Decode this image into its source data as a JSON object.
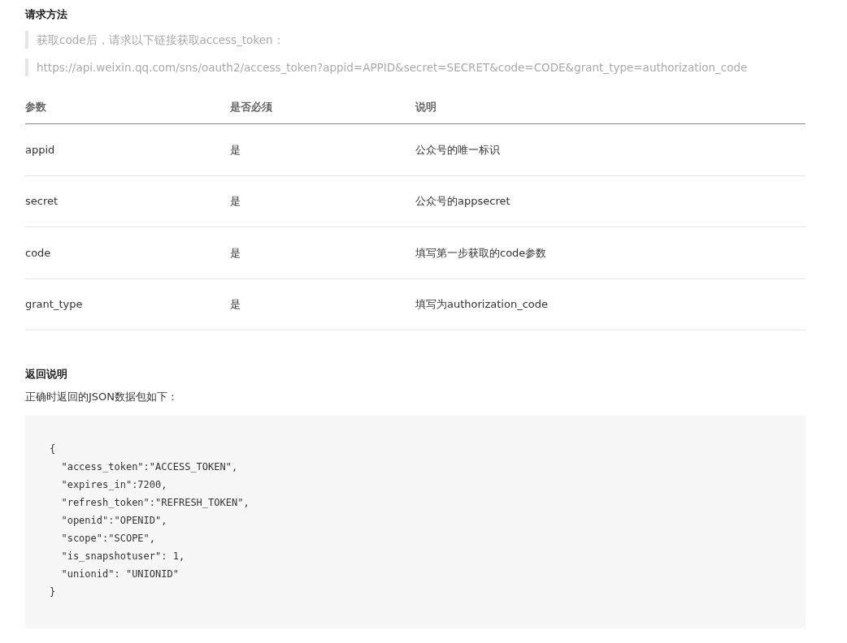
{
  "request_section": {
    "heading": "请求方法",
    "quotes": [
      "获取code后，请求以下链接获取access_token：",
      "https://api.weixin.qq.com/sns/oauth2/access_token?appid=APPID&secret=SECRET&code=CODE&grant_type=authorization_code"
    ]
  },
  "table": {
    "columns": [
      "参数",
      "是否必须",
      "说明"
    ],
    "rows": [
      [
        "appid",
        "是",
        "公众号的唯一标识"
      ],
      [
        "secret",
        "是",
        "公众号的appsecret"
      ],
      [
        "code",
        "是",
        "填写第一步获取的code参数"
      ],
      [
        "grant_type",
        "是",
        "填写为authorization_code"
      ]
    ]
  },
  "response_section": {
    "heading": "返回说明",
    "text": "正确时返回的JSON数据包如下：",
    "code_lines": [
      "{",
      "  \"access_token\":\"ACCESS_TOKEN\",",
      "  \"expires_in\":7200,",
      "  \"refresh_token\":\"REFRESH_TOKEN\",",
      "  \"openid\":\"OPENID\",",
      "  \"scope\":\"SCOPE\",",
      "  \"is_snapshotuser\": 1,",
      "  \"unionid\": \"UNIONID\"",
      "}"
    ]
  }
}
